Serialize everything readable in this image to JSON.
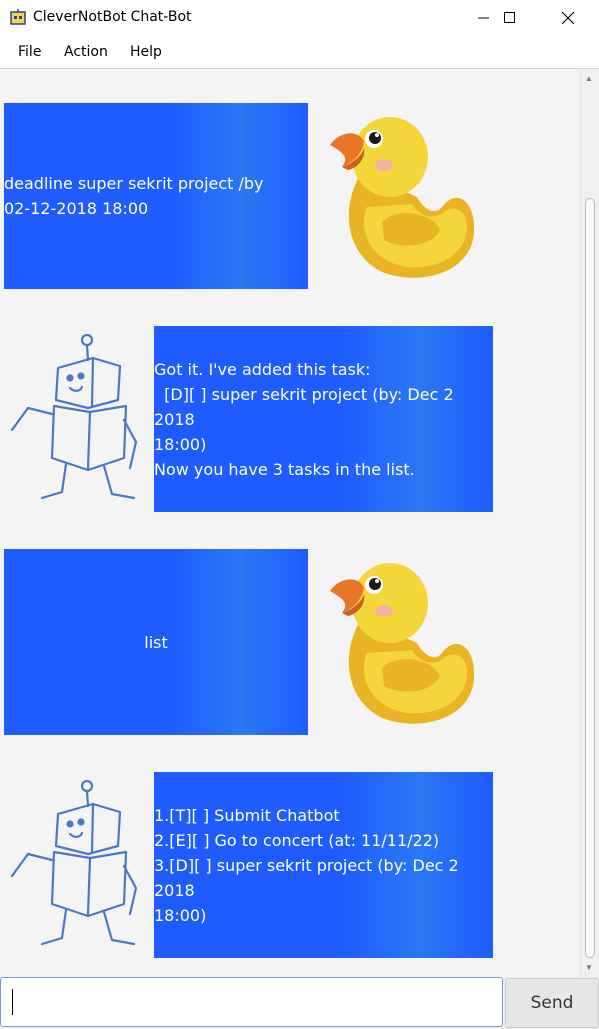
{
  "window": {
    "title": "CleverNotBot Chat-Bot",
    "icons": {
      "app": "robot-app-icon",
      "minimize": "minimize-icon",
      "maximize": "maximize-icon",
      "close": "close-icon"
    }
  },
  "menu": {
    "file": "File",
    "action": "Action",
    "help": "Help"
  },
  "chat": {
    "messages": [
      {
        "sender": "user",
        "avatar": "duck-avatar",
        "text": "deadline super sekrit project /by\n02-12-2018 18:00"
      },
      {
        "sender": "bot",
        "avatar": "robot-avatar",
        "text": "Got it. I've added this task:\n  [D][ ] super sekrit project (by: Dec 2 2018\n18:00)\nNow you have 3 tasks in the list."
      },
      {
        "sender": "user",
        "avatar": "duck-avatar",
        "text": "list"
      },
      {
        "sender": "bot",
        "avatar": "robot-avatar",
        "text": "1.[T][ ] Submit Chatbot\n2.[E][ ] Go to concert (at: 11/11/22)\n3.[D][ ] super sekrit project (by: Dec 2 2018\n18:00)"
      }
    ]
  },
  "input": {
    "value": "",
    "placeholder": ""
  },
  "send_label": "Send",
  "colors": {
    "bubble": "#1e5cff",
    "bubble_highlight": "#2a78f2",
    "duck_body": "#f5d63a",
    "duck_beak": "#e8762a",
    "robot_stroke": "#4a78c4"
  }
}
